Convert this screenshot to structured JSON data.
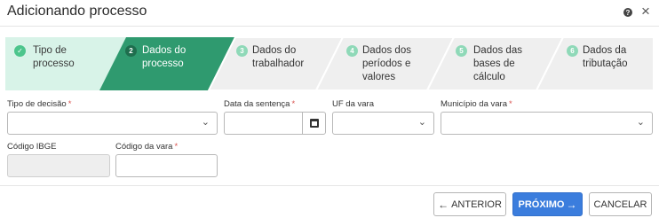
{
  "header": {
    "title": "Adicionando processo",
    "help_icon": "?",
    "close_icon": "×"
  },
  "stepper": {
    "steps": [
      {
        "num": "✓",
        "label": "Tipo de processo",
        "state": "completed"
      },
      {
        "num": "2",
        "label": "Dados do processo",
        "state": "active"
      },
      {
        "num": "3",
        "label": "Dados do trabalhador",
        "state": "pending"
      },
      {
        "num": "4",
        "label": "Dados dos períodos e valores",
        "state": "pending"
      },
      {
        "num": "5",
        "label": "Dados das bases de cálculo",
        "state": "pending"
      },
      {
        "num": "6",
        "label": "Dados da tributação",
        "state": "pending"
      }
    ],
    "colors": {
      "completed_bg": "#d8f3e8",
      "completed_badge": "#4cc58c",
      "active_bg": "#2f9a6f",
      "pending_bg": "#efefef",
      "pending_badge": "#8fd9b8"
    }
  },
  "form": {
    "tipo_decisao": {
      "label": "Tipo de decisão",
      "required": "*",
      "value": ""
    },
    "data_sentenca": {
      "label": "Data da sentença",
      "required": "*",
      "value": ""
    },
    "uf_vara": {
      "label": "UF da vara",
      "value": ""
    },
    "municipio_vara": {
      "label": "Município da vara",
      "required": "*",
      "value": ""
    },
    "codigo_ibge": {
      "label": "Código IBGE",
      "value": ""
    },
    "codigo_vara": {
      "label": "Código da vara",
      "required": "*",
      "value": ""
    }
  },
  "footer": {
    "anterior": "ANTERIOR",
    "proximo": "PRÓXIMO",
    "cancelar": "CANCELAR",
    "arrow_left": "←",
    "arrow_right": "→"
  },
  "icons": {
    "chevron": "⌄"
  }
}
